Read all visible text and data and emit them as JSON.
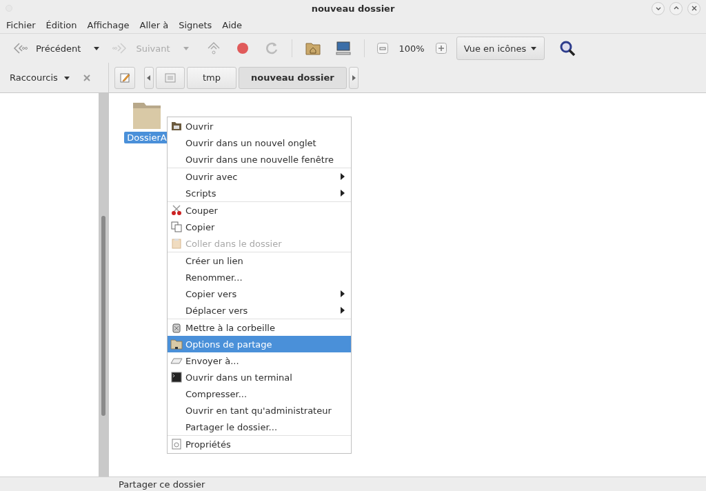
{
  "window": {
    "title": "nouveau dossier"
  },
  "menubar": [
    "Fichier",
    "Édition",
    "Affichage",
    "Aller à",
    "Signets",
    "Aide"
  ],
  "toolbar": {
    "back": {
      "label": "Précédent",
      "disabled": false
    },
    "forward": {
      "label": "Suivant",
      "disabled": true
    },
    "zoom": "100%",
    "view": "Vue en icônes"
  },
  "sidebar": {
    "title": "Raccourcis"
  },
  "path": [
    {
      "label": "tmp",
      "selected": false
    },
    {
      "label": "nouveau dossier",
      "selected": true
    }
  ],
  "files": [
    {
      "name": "DossierA",
      "selected": true
    }
  ],
  "context_menu": [
    [
      {
        "label": "Ouvrir",
        "kind": "folder",
        "submenu": false,
        "disabled": false,
        "selected": false
      },
      {
        "label": "Ouvrir dans un nouvel onglet",
        "kind": "plain",
        "submenu": false,
        "disabled": false,
        "selected": false
      },
      {
        "label": "Ouvrir dans une nouvelle fenêtre",
        "kind": "plain",
        "submenu": false,
        "disabled": false,
        "selected": false
      }
    ],
    [
      {
        "label": "Ouvrir avec",
        "kind": "plain",
        "submenu": true,
        "disabled": false,
        "selected": false
      },
      {
        "label": "Scripts",
        "kind": "plain",
        "submenu": true,
        "disabled": false,
        "selected": false
      }
    ],
    [
      {
        "label": "Couper",
        "kind": "scissors",
        "submenu": false,
        "disabled": false,
        "selected": false
      },
      {
        "label": "Copier",
        "kind": "copy",
        "submenu": false,
        "disabled": false,
        "selected": false
      },
      {
        "label": "Coller dans le dossier",
        "kind": "paste",
        "submenu": false,
        "disabled": true,
        "selected": false
      }
    ],
    [
      {
        "label": "Créer un lien",
        "kind": "plain",
        "submenu": false,
        "disabled": false,
        "selected": false
      },
      {
        "label": "Renommer...",
        "kind": "plain",
        "submenu": false,
        "disabled": false,
        "selected": false
      },
      {
        "label": "Copier vers",
        "kind": "plain",
        "submenu": true,
        "disabled": false,
        "selected": false
      },
      {
        "label": "Déplacer vers",
        "kind": "plain",
        "submenu": true,
        "disabled": false,
        "selected": false
      }
    ],
    [
      {
        "label": "Mettre à la corbeille",
        "kind": "trash",
        "submenu": false,
        "disabled": false,
        "selected": false
      },
      {
        "label": "Options de partage",
        "kind": "share",
        "submenu": false,
        "disabled": false,
        "selected": true
      },
      {
        "label": "Envoyer à...",
        "kind": "send",
        "submenu": false,
        "disabled": false,
        "selected": false
      },
      {
        "label": "Ouvrir dans un terminal",
        "kind": "terminal",
        "submenu": false,
        "disabled": false,
        "selected": false
      },
      {
        "label": "Compresser...",
        "kind": "plain",
        "submenu": false,
        "disabled": false,
        "selected": false
      },
      {
        "label": "Ouvrir en tant qu'administrateur",
        "kind": "plain",
        "submenu": false,
        "disabled": false,
        "selected": false
      },
      {
        "label": "Partager le dossier...",
        "kind": "plain",
        "submenu": false,
        "disabled": false,
        "selected": false
      }
    ],
    [
      {
        "label": "Propriétés",
        "kind": "properties",
        "submenu": false,
        "disabled": false,
        "selected": false
      }
    ]
  ],
  "status_bar": "Partager ce dossier"
}
